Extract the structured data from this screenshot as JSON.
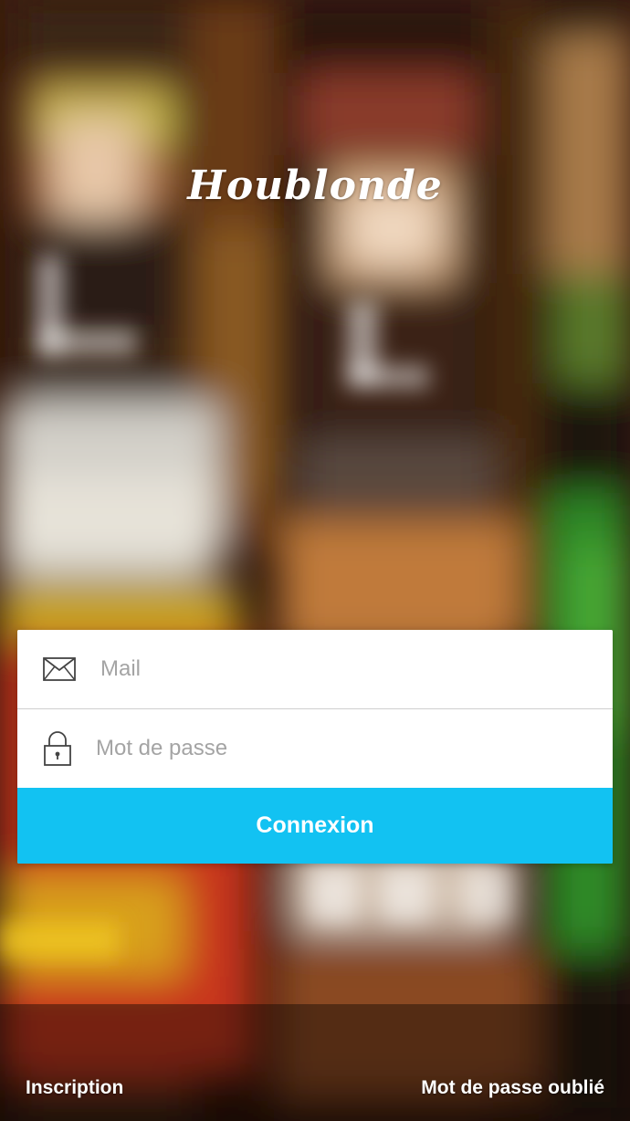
{
  "app": {
    "logo_text": "Houblonde"
  },
  "login_form": {
    "email": {
      "placeholder": "Mail",
      "value": "",
      "icon": "envelope-icon"
    },
    "password": {
      "placeholder": "Mot de passe",
      "value": "",
      "icon": "padlock-icon"
    },
    "submit_label": "Connexion"
  },
  "footer": {
    "signup_label": "Inscription",
    "forgot_password_label": "Mot de passe oublié"
  },
  "colors": {
    "accent": "#12c2f2",
    "field_background": "#ffffff",
    "placeholder": "#a4a4a4",
    "divider": "#cfcfcf",
    "text_on_photo": "#ffffff"
  }
}
